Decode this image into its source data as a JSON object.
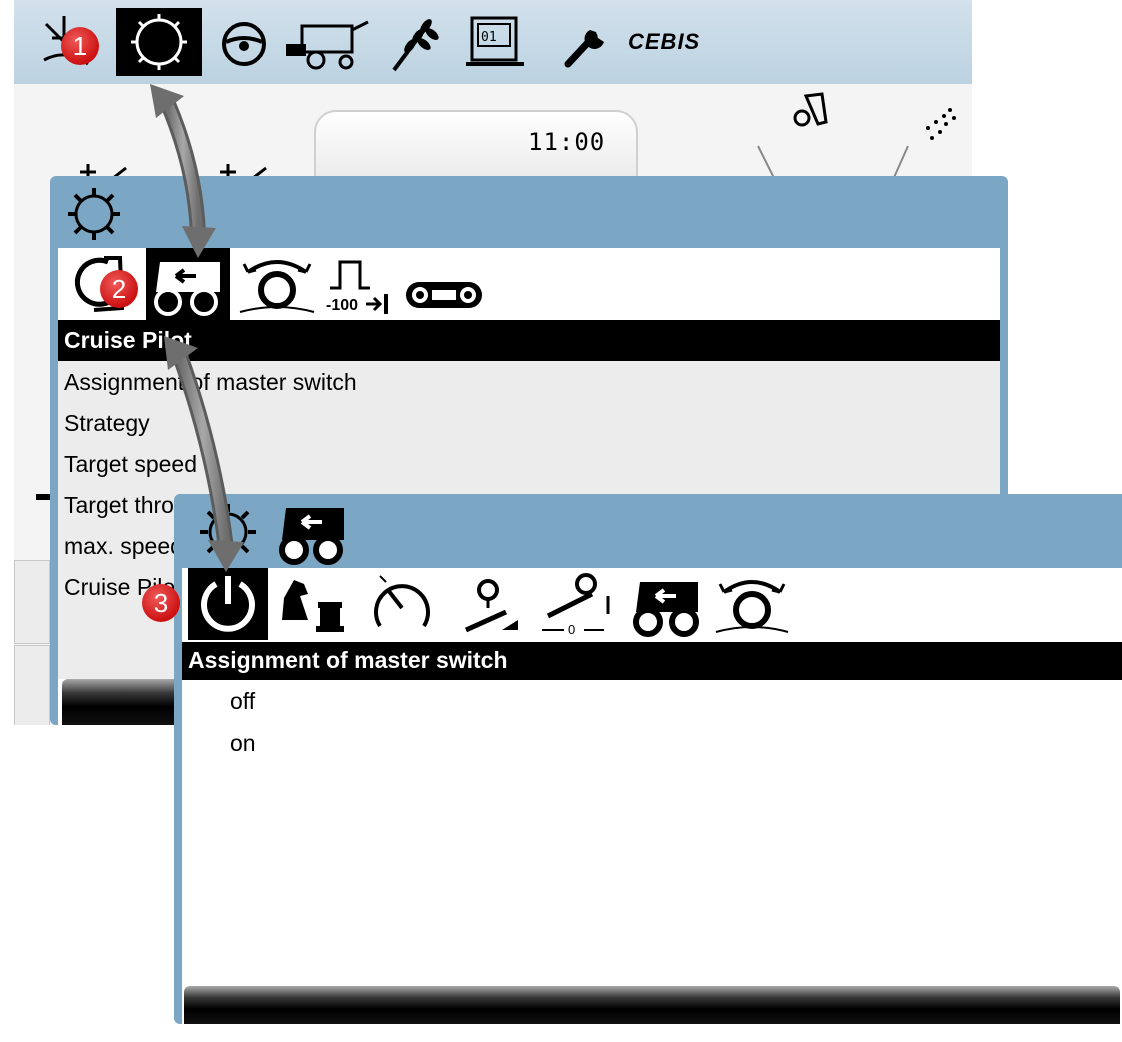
{
  "top_menu": {
    "items": [
      {
        "icon": "light-icon"
      },
      {
        "icon": "machine-settings-gear-icon",
        "selected": true
      },
      {
        "icon": "steering-wheel-icon"
      },
      {
        "icon": "combine-harvester-icon"
      },
      {
        "icon": "crop-wheat-icon"
      },
      {
        "icon": "counter-display-icon"
      },
      {
        "icon": "wrench-icon"
      }
    ],
    "cebis_label": "CEBIS"
  },
  "main_screen": {
    "clock": "11:00"
  },
  "panel_mid": {
    "title_icon": "gear-icon",
    "tabs": [
      {
        "icon": "engine-icon"
      },
      {
        "icon": "cruise-pilot-tractor-icon",
        "selected": true
      },
      {
        "icon": "threshing-drum-icon"
      },
      {
        "icon": "header-height-100-icon"
      },
      {
        "icon": "track-drive-icon"
      }
    ],
    "header": "Cruise Pilot",
    "items": [
      "Assignment of master switch",
      "Strategy",
      "Target speed",
      "Target throughput",
      "max. speed",
      "Cruise Pilot"
    ]
  },
  "panel_front": {
    "title_icons": [
      "gear-icon",
      "cruise-pilot-tractor-icon"
    ],
    "tabs": [
      {
        "icon": "power-icon",
        "selected": true
      },
      {
        "icon": "strategy-chess-icon"
      },
      {
        "icon": "speedometer-icon"
      },
      {
        "icon": "feed-rate-icon"
      },
      {
        "icon": "throughput-calibration-icon"
      },
      {
        "icon": "cruise-pilot-tractor-icon"
      },
      {
        "icon": "threshing-drum-icon"
      }
    ],
    "header": "Assignment of master switch",
    "options": [
      "off",
      "on"
    ]
  },
  "badges": [
    "1",
    "2",
    "3"
  ],
  "colors": {
    "panel_frame": "#7ba6c4",
    "top_menu": "#c6d9e6",
    "badge_red": "#cc1111",
    "arrow_gray": "#888888"
  }
}
